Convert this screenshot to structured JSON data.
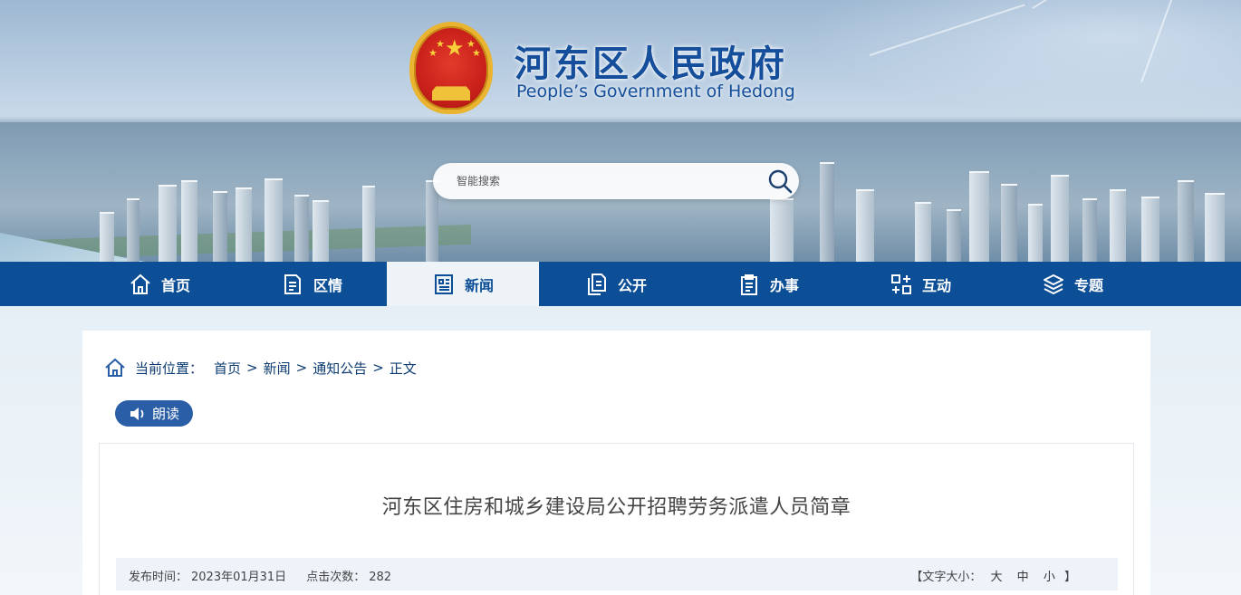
{
  "header": {
    "site_title": "河东区人民政府",
    "site_subtitle": "People’s Government of Hedong",
    "search_placeholder": "智能搜索"
  },
  "nav": {
    "items": [
      {
        "label": "首页",
        "icon": "home-icon"
      },
      {
        "label": "区情",
        "icon": "document-icon"
      },
      {
        "label": "新闻",
        "icon": "news-icon",
        "active": true
      },
      {
        "label": "公开",
        "icon": "files-icon"
      },
      {
        "label": "办事",
        "icon": "clipboard-icon"
      },
      {
        "label": "互动",
        "icon": "interact-icon"
      },
      {
        "label": "专题",
        "icon": "layers-icon"
      }
    ]
  },
  "breadcrumb": {
    "label": "当前位置：",
    "items": [
      "首页",
      "新闻",
      "通知公告",
      "正文"
    ],
    "separator": ">"
  },
  "read_button": {
    "label": "朗读"
  },
  "article": {
    "title": "河东区住房和城乡建设局公开招聘劳务派遣人员简章",
    "publish_label": "发布时间：",
    "publish_date": "2023年01月31日",
    "views_label": "点击次数：",
    "views": "282",
    "font_size_open": "【文字大小：",
    "font_size_large": "大",
    "font_size_medium": "中",
    "font_size_small": "小",
    "font_size_close": "】"
  },
  "colors": {
    "nav_bg": "#0d4f96",
    "title_blue": "#154e9a",
    "read_button_bg": "#2a5ea6"
  }
}
